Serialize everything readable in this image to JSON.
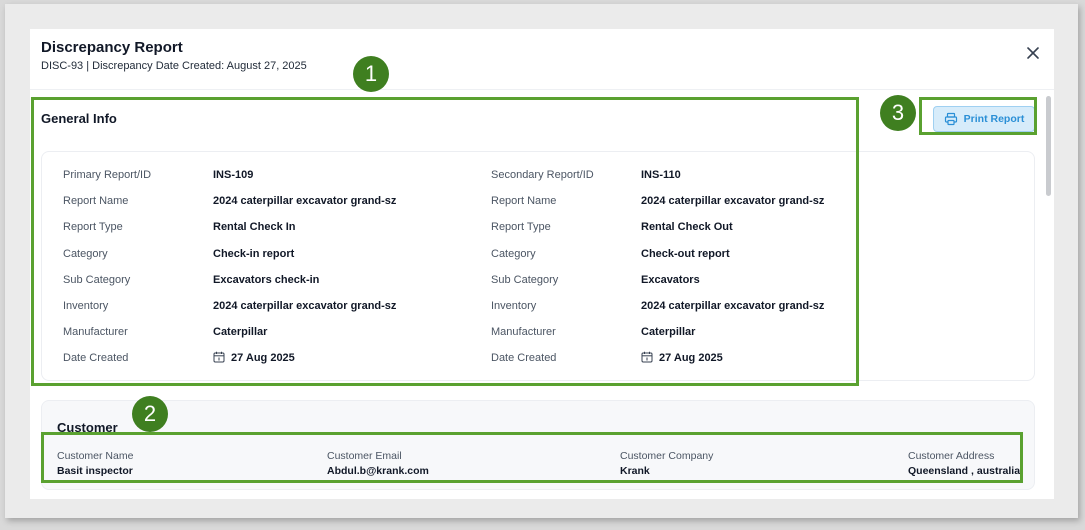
{
  "modal": {
    "title": "Discrepancy Report",
    "subtitle": "DISC-93 | Discrepancy Date Created: August 27, 2025",
    "close_icon": "close-icon"
  },
  "general_info": {
    "title": "General Info",
    "print_button": "Print Report",
    "primary": [
      {
        "label": "Primary Report/ID",
        "value": "INS-109"
      },
      {
        "label": "Report Name",
        "value": "2024 caterpillar excavator grand-sz"
      },
      {
        "label": "Report Type",
        "value": "Rental Check In"
      },
      {
        "label": "Category",
        "value": "Check-in report"
      },
      {
        "label": "Sub Category",
        "value": "Excavators check-in"
      },
      {
        "label": "Inventory",
        "value": "2024 caterpillar excavator grand-sz"
      },
      {
        "label": "Manufacturer",
        "value": "Caterpillar"
      },
      {
        "label": "Date Created",
        "value": "27 Aug 2025"
      }
    ],
    "secondary": [
      {
        "label": "Secondary Report/ID",
        "value": "INS-110"
      },
      {
        "label": "Report Name",
        "value": "2024 caterpillar excavator grand-sz"
      },
      {
        "label": "Report Type",
        "value": "Rental Check Out"
      },
      {
        "label": "Category",
        "value": "Check-out report"
      },
      {
        "label": "Sub Category",
        "value": "Excavators"
      },
      {
        "label": "Inventory",
        "value": "2024 caterpillar excavator grand-sz"
      },
      {
        "label": "Manufacturer",
        "value": "Caterpillar"
      },
      {
        "label": "Date Created",
        "value": "27 Aug 2025"
      }
    ]
  },
  "customer": {
    "title": "Customer",
    "fields": [
      {
        "label": "Customer Name",
        "value": "Basit inspector"
      },
      {
        "label": "Customer Email",
        "value": "Abdul.b@krank.com"
      },
      {
        "label": "Customer Company",
        "value": "Krank"
      },
      {
        "label": "Customer Address",
        "value": "Queensland , australia"
      }
    ]
  },
  "annotations": [
    "1",
    "2",
    "3"
  ],
  "colors": {
    "highlight": "#5aa130",
    "badge": "#3f7f20",
    "print_button_bg": "#d7ecfa",
    "print_button_text": "#2a8fd6"
  }
}
